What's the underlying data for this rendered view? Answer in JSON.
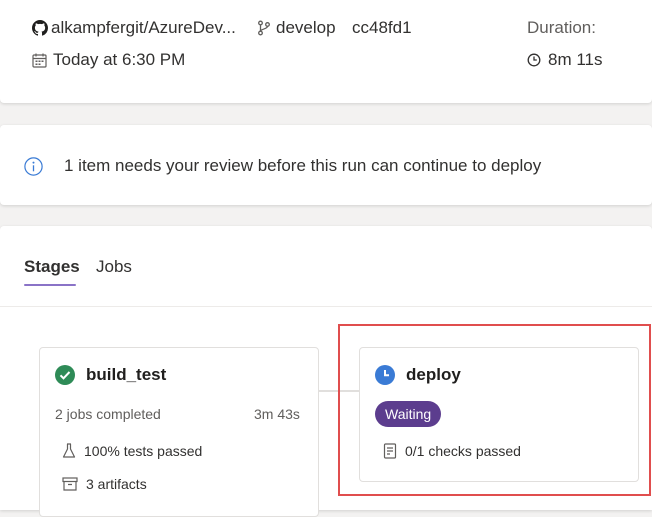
{
  "run": {
    "repo": "alkampfergit/AzureDev...",
    "branch": "develop",
    "commit": "cc48fd1",
    "date": "Today at 6:30 PM",
    "duration_label": "Duration:",
    "duration_value": "8m 11s"
  },
  "review": {
    "message": "1 item needs your review before this run can continue to deploy"
  },
  "tabs": [
    {
      "label": "Stages",
      "active": true
    },
    {
      "label": "Jobs",
      "active": false
    }
  ],
  "stages": [
    {
      "name": "build_test",
      "status": "success",
      "jobs_text": "2 jobs completed",
      "duration": "3m 43s",
      "tests": "100% tests passed",
      "artifacts": "3 artifacts"
    },
    {
      "name": "deploy",
      "status": "waiting",
      "badge": "Waiting",
      "checks": "0/1 checks passed"
    }
  ],
  "colors": {
    "success": "#2e8b57",
    "waiting_icon": "#3a7bd5",
    "badge_bg": "#5c3d8e",
    "highlight": "#e04e4e",
    "tab_underline": "#8a73c7"
  }
}
